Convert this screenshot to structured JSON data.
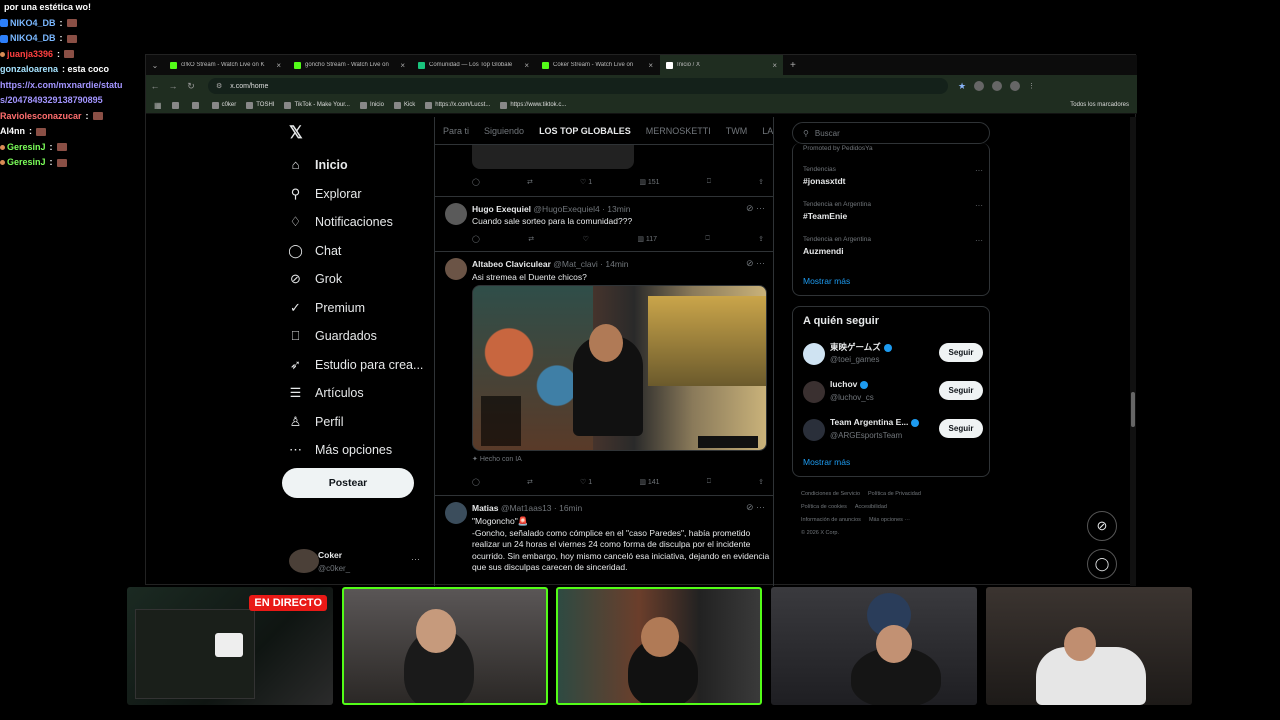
{
  "chat": {
    "lines": [
      {
        "user": "",
        "text": "por una estética wo!",
        "color": "#ffffff"
      },
      {
        "user": "NIKO4_DB",
        "text": ":",
        "color": "#7ab8ff"
      },
      {
        "user": "NIKO4_DB",
        "text": ":",
        "color": "#7ab8ff"
      },
      {
        "user": "juanja3396",
        "text": ":",
        "color": "#ff4040"
      },
      {
        "user": "gonzaloarena",
        "text": ": esta coco",
        "color": "#a6e3ff"
      },
      {
        "user": "https://x.com/mxnardie/statu",
        "text": "",
        "color": "#a395ff"
      },
      {
        "user": "s/2047849329138790895",
        "text": "",
        "color": "#a395ff"
      },
      {
        "user": "Raviolesconazucar",
        "text": ":",
        "color": "#ff6e6e"
      },
      {
        "user": "Al4nn",
        "text": ":",
        "color": "#ffffff"
      },
      {
        "user": "GeresinJ",
        "text": ":",
        "color": "#7cff5a"
      },
      {
        "user": "GeresinJ",
        "text": ":",
        "color": "#7cff5a"
      }
    ]
  },
  "browser": {
    "tabs": [
      {
        "label": "cl!kO Stream - Watch Live on K",
        "icon": "kick"
      },
      {
        "label": "goncho Stream - Watch Live on",
        "icon": "kick"
      },
      {
        "label": "Comunidad — Los Top Globale",
        "icon": "tg"
      },
      {
        "label": "Coker Stream - Watch Live on",
        "icon": "kick"
      },
      {
        "label": "Inicio / X",
        "icon": "x"
      }
    ],
    "url": "x.com/home",
    "bookmarks": [
      "",
      "",
      "c0ker",
      "TOSHI",
      "TikTok - Make Your...",
      "Inicio",
      "Kick",
      "https://x.com/Lucst...",
      "https://www.tiktok.c..."
    ],
    "all_bookmarks": "Todos los marcadores"
  },
  "nav": {
    "items": [
      {
        "label": "Inicio",
        "icon": "home-icon",
        "glyph": "⌂"
      },
      {
        "label": "Explorar",
        "icon": "search-icon",
        "glyph": "⚲"
      },
      {
        "label": "Notificaciones",
        "icon": "bell-icon",
        "glyph": "♢"
      },
      {
        "label": "Chat",
        "icon": "chat-icon",
        "glyph": "◯"
      },
      {
        "label": "Grok",
        "icon": "grok-icon",
        "glyph": "⊘"
      },
      {
        "label": "Premium",
        "icon": "premium-icon",
        "glyph": "✓"
      },
      {
        "label": "Guardados",
        "icon": "bookmark-icon",
        "glyph": "⎕"
      },
      {
        "label": "Estudio para crea...",
        "icon": "rocket-icon",
        "glyph": "➶"
      },
      {
        "label": "Artículos",
        "icon": "article-icon",
        "glyph": "☰"
      },
      {
        "label": "Perfil",
        "icon": "profile-icon",
        "glyph": "♙"
      },
      {
        "label": "Más opciones",
        "icon": "more-icon",
        "glyph": "⋯"
      }
    ],
    "post_label": "Postear",
    "account": {
      "name": "Coker",
      "handle": "@c0ker_"
    }
  },
  "feed": {
    "tabs": [
      "Para ti",
      "Siguiendo",
      "LOS TOP GLOBALES",
      "MERNOSKETTI",
      "TWM",
      "LA"
    ],
    "active_tab": "LOS TOP GLOBALES",
    "top_actions": {
      "likes": "1",
      "views": "151"
    },
    "tweets": [
      {
        "name": "Hugo Exequiel",
        "handle": "@HugoExequiel4",
        "time": "13min",
        "text": "Cuando sale sorteo para la comunidad???",
        "likes": "",
        "views": "117"
      },
      {
        "name": "Altabeo Claviculear",
        "handle": "@Mat_clavi",
        "time": "14min",
        "text": "Asi stremea el Duente chicos?",
        "ai_label": "Hecho con IA",
        "likes": "1",
        "views": "141"
      },
      {
        "name": "Matias",
        "handle": "@Mat1aas13",
        "time": "16min",
        "text": "\"Mogoncho\"🚨\n-Goncho, señalado como cómplice en el \"caso Paredes\", había prometido realizar un 24 horas el viernes 24 como forma de disculpa por el incidente ocurrido. Sin embargo, hoy mismo canceló esa iniciativa, dejando en evidencia que sus disculpas carecen de sinceridad."
      }
    ]
  },
  "sidebar": {
    "search_placeholder": "Buscar",
    "promoted": "Promoted by PedidosYa",
    "trends": [
      {
        "context": "Tendencias",
        "name": "#jonasxtdt"
      },
      {
        "context": "Tendencia en Argentina",
        "name": "#TeamEnie"
      },
      {
        "context": "Tendencia en Argentina",
        "name": "Auzmendi"
      }
    ],
    "show_more": "Mostrar más",
    "follow_title": "A quién seguir",
    "follow": [
      {
        "name": "東映ゲームズ",
        "handle": "@toei_games",
        "button": "Seguir"
      },
      {
        "name": "luchov",
        "handle": "@luchov_cs",
        "button": "Seguir"
      },
      {
        "name": "Team Argentina E...",
        "handle": "@ARGEsportsTeam",
        "button": "Seguir"
      }
    ],
    "footer": [
      "Condiciones de Servicio",
      "Política de Privacidad",
      "Política de cookies",
      "Accesibilidad",
      "Información de anuncios",
      "Más opciones ···",
      "© 2026 X Corp."
    ]
  },
  "cams": {
    "live_label": "EN DIRECTO"
  },
  "colors": {
    "accent": "#1d9bf0",
    "kick": "#53fc18",
    "live": "#e91916"
  }
}
